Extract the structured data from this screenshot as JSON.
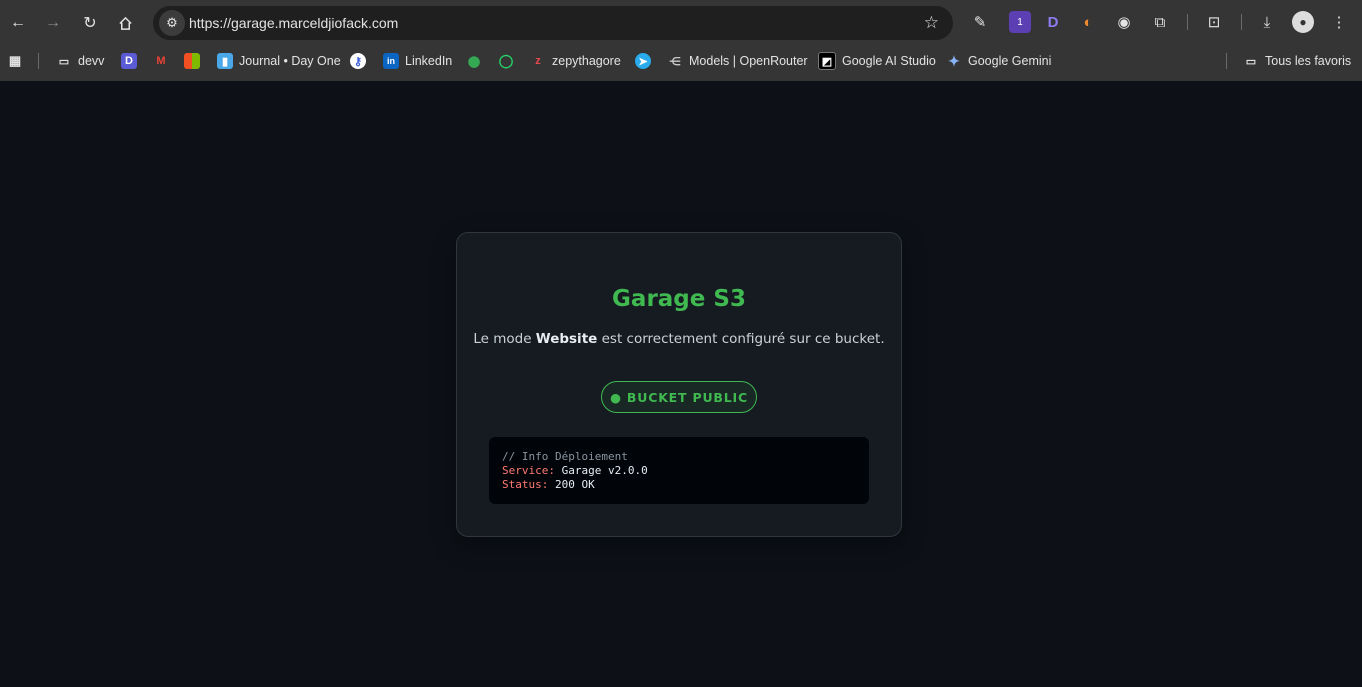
{
  "browser": {
    "url": "https://garage.marceldjiofack.com",
    "bookmarks": [
      {
        "label": "devv",
        "icon": "folder-icon"
      },
      {
        "label": "",
        "icon": "blue-d-icon"
      },
      {
        "label": "",
        "icon": "gmail-icon"
      },
      {
        "label": "",
        "icon": "microsoft-icon"
      },
      {
        "label": "Journal • Day One",
        "icon": "journal-icon"
      },
      {
        "label": "",
        "icon": "key-icon"
      },
      {
        "label": "LinkedIn",
        "icon": "linkedin-icon"
      },
      {
        "label": "",
        "icon": "maps-icon"
      },
      {
        "label": "",
        "icon": "whatsapp-icon"
      },
      {
        "label": "zepythagore",
        "icon": "z-icon"
      },
      {
        "label": "",
        "icon": "telegram-icon"
      },
      {
        "label": "Models | OpenRouter",
        "icon": "openrouter-icon"
      },
      {
        "label": "Google AI Studio",
        "icon": "ai-studio-icon"
      },
      {
        "label": "Google Gemini",
        "icon": "gemini-icon"
      }
    ],
    "all_bookmarks_label": "Tous les favoris",
    "extension_badge": "1"
  },
  "page": {
    "title": "Garage S3",
    "desc_prefix": "Le mode ",
    "desc_bold": "Website",
    "desc_suffix": " est correctement configuré sur ce bucket.",
    "badge_label": "● BUCKET PUBLIC",
    "code": {
      "comment": "// Info Déploiement",
      "service_key": "Service:",
      "service_value": " Garage v2.0.0",
      "status_key": "Status:",
      "status_value": " 200 OK"
    }
  },
  "colors": {
    "background": "#0d1117",
    "card": "#161b22",
    "accent": "#3fb950",
    "code_key": "#ff7b72"
  }
}
